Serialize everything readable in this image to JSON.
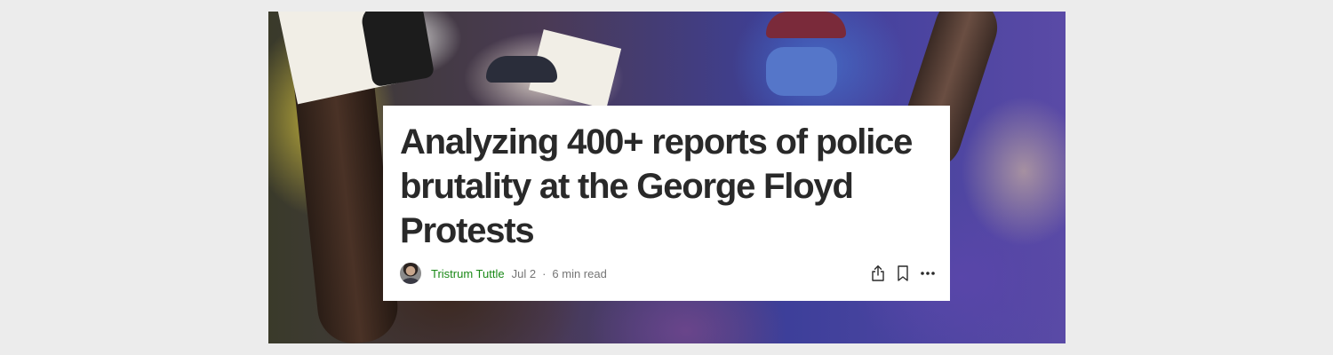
{
  "article": {
    "title": "Analyzing 400+ reports of police brutality at the George Floyd Protests",
    "author": "Tristrum Tuttle",
    "date": "Jul 2",
    "separator": "·",
    "read_time": "6 min read"
  },
  "icons": {
    "share": "share-icon",
    "bookmark": "bookmark-icon",
    "more": "more-icon",
    "avatar": "author-avatar"
  },
  "colors": {
    "author_link": "#1a8917",
    "title": "#292929",
    "meta_text": "#757575",
    "page_background": "#ececec",
    "card_background": "#ffffff"
  }
}
